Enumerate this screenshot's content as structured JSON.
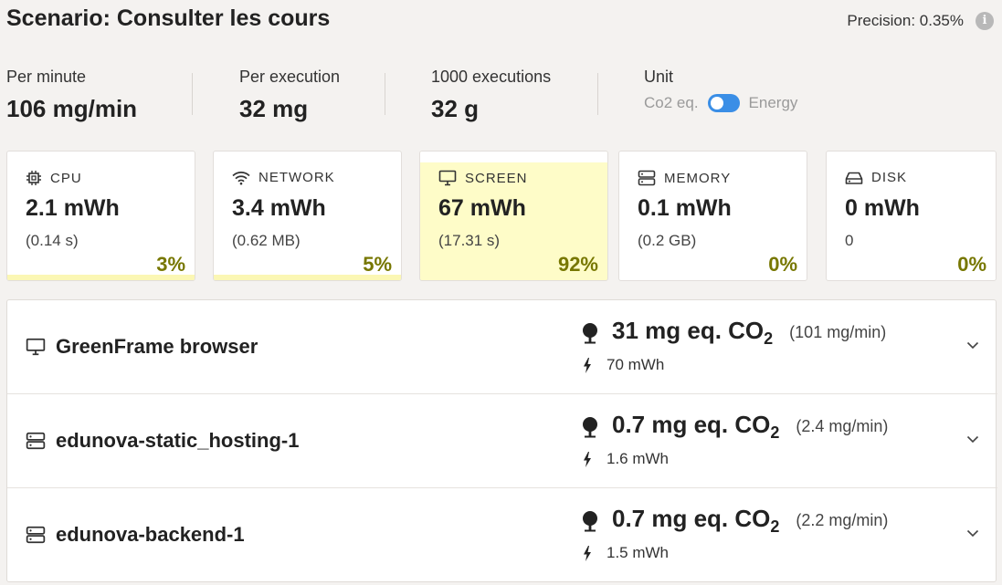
{
  "header": {
    "title": "Scenario: Consulter les cours",
    "precision": "Precision: 0.35%"
  },
  "stats": [
    {
      "label": "Per minute",
      "value": "106 mg/min"
    },
    {
      "label": "Per execution",
      "value": "32 mg"
    },
    {
      "label": "1000 executions",
      "value": "32 g"
    }
  ],
  "unit": {
    "label": "Unit",
    "left": "Co2 eq.",
    "right": "Energy",
    "toggle_on": true
  },
  "cards": [
    {
      "icon": "cpu-icon",
      "label": "CPU",
      "value": "2.1 mWh",
      "sub": "(0.14 s)",
      "percent": "3%",
      "share": 3
    },
    {
      "icon": "wifi-icon",
      "label": "NETWORK",
      "value": "3.4 mWh",
      "sub": "(0.62 MB)",
      "percent": "5%",
      "share": 5
    },
    {
      "icon": "monitor-icon",
      "label": "SCREEN",
      "value": "67 mWh",
      "sub": "(17.31 s)",
      "percent": "92%",
      "share": 92
    },
    {
      "icon": "storage-icon",
      "label": "MEMORY",
      "value": "0.1 mWh",
      "sub": "(0.2 GB)",
      "percent": "0%",
      "share": 0
    },
    {
      "icon": "disk-icon",
      "label": "DISK",
      "value": "0 mWh",
      "sub": "0",
      "percent": "0%",
      "share": 0
    }
  ],
  "containers": [
    {
      "icon": "monitor-icon",
      "name": "GreenFrame browser",
      "co2": "31 mg eq. CO",
      "co2_sub": "2",
      "rate": "(101 mg/min)",
      "energy": "70 mWh"
    },
    {
      "icon": "storage-icon",
      "name": "edunova-static_hosting-1",
      "co2": "0.7 mg eq. CO",
      "co2_sub": "2",
      "rate": "(2.4 mg/min)",
      "energy": "1.6 mWh"
    },
    {
      "icon": "storage-icon",
      "name": "edunova-backend-1",
      "co2": "0.7 mg eq. CO",
      "co2_sub": "2",
      "rate": "(2.2 mg/min)",
      "energy": "1.5 mWh"
    }
  ],
  "colors": {
    "accent": "#3a8ee6",
    "highlight": "#fefcc8",
    "percent_text": "#777700"
  }
}
